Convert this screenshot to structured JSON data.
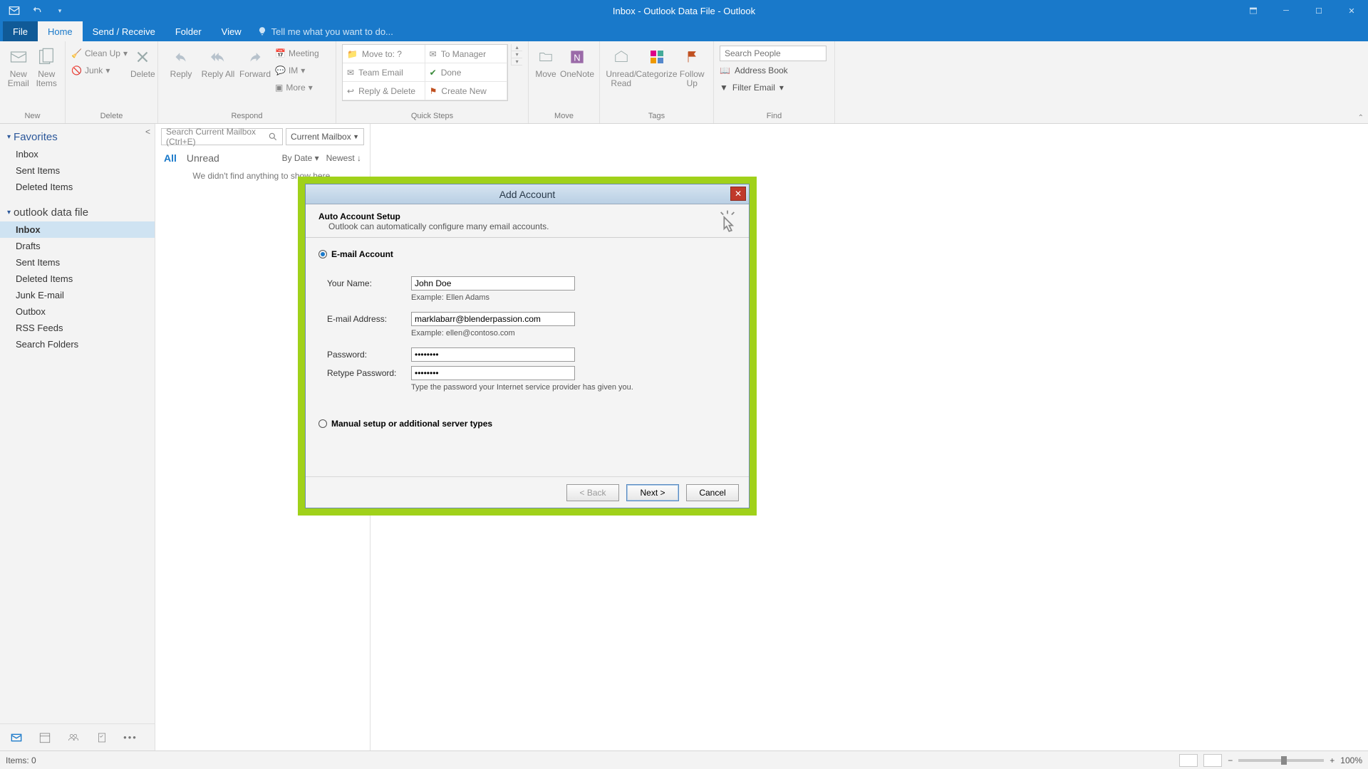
{
  "window": {
    "title": "Inbox - Outlook Data File - Outlook"
  },
  "tabs": {
    "file": "File",
    "home": "Home",
    "sendreceive": "Send / Receive",
    "folder": "Folder",
    "view": "View",
    "tellme": "Tell me what you want to do..."
  },
  "ribbon": {
    "new": {
      "email": "New Email",
      "items": "New Items",
      "group": "New"
    },
    "delete": {
      "cleanup": "Clean Up",
      "junk": "Junk",
      "delete": "Delete",
      "group": "Delete"
    },
    "respond": {
      "reply": "Reply",
      "replyall": "Reply All",
      "forward": "Forward",
      "meeting": "Meeting",
      "im": "IM",
      "more": "More",
      "group": "Respond"
    },
    "quicksteps": {
      "moveto": "Move to: ?",
      "tomanager": "To Manager",
      "teamemail": "Team Email",
      "done": "Done",
      "replydelete": "Reply & Delete",
      "createnew": "Create New",
      "group": "Quick Steps"
    },
    "move": {
      "move": "Move",
      "onenote": "OneNote",
      "group": "Move"
    },
    "tags": {
      "unread": "Unread/ Read",
      "categorize": "Categorize",
      "followup": "Follow Up",
      "group": "Tags"
    },
    "find": {
      "search_ph": "Search People",
      "addressbook": "Address Book",
      "filter": "Filter Email",
      "group": "Find"
    }
  },
  "nav": {
    "favorites": "Favorites",
    "fav_items": [
      "Inbox",
      "Sent Items",
      "Deleted Items"
    ],
    "datafile": "outlook data file",
    "folders": [
      "Inbox",
      "Drafts",
      "Sent Items",
      "Deleted Items",
      "Junk E-mail",
      "Outbox",
      "RSS Feeds",
      "Search Folders"
    ]
  },
  "list": {
    "search_ph": "Search Current Mailbox (Ctrl+E)",
    "scope": "Current Mailbox",
    "all": "All",
    "unread": "Unread",
    "bydate": "By Date",
    "newest": "Newest",
    "empty": "We didn't find anything to show here."
  },
  "status": {
    "items": "Items: 0",
    "zoom": "100%"
  },
  "dialog": {
    "title": "Add Account",
    "heading": "Auto Account Setup",
    "sub": "Outlook can automatically configure many email accounts.",
    "opt_email": "E-mail Account",
    "lbl_name": "Your Name:",
    "val_name": "John Doe",
    "hint_name": "Example: Ellen Adams",
    "lbl_email": "E-mail Address:",
    "val_email": "marklabarr@blenderpassion.com",
    "hint_email": "Example: ellen@contoso.com",
    "lbl_pw": "Password:",
    "val_pw": "********",
    "lbl_pw2": "Retype Password:",
    "val_pw2": "********",
    "hint_pw": "Type the password your Internet service provider has given you.",
    "opt_manual": "Manual setup or additional server types",
    "back": "< Back",
    "next": "Next >",
    "cancel": "Cancel"
  }
}
